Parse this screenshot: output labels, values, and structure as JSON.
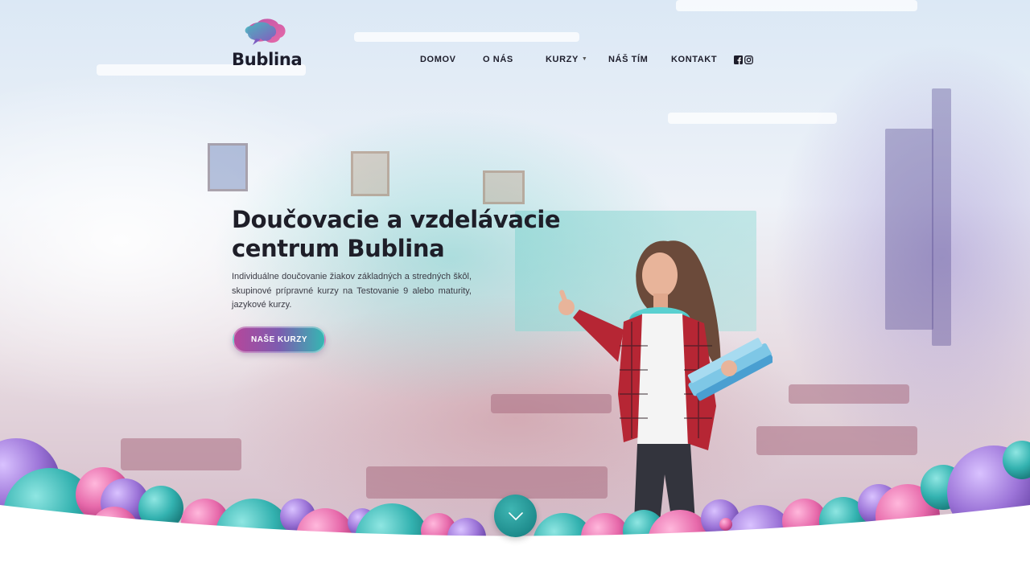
{
  "brand": {
    "name": "Bublina"
  },
  "nav": {
    "items": [
      {
        "label": "DOMOV"
      },
      {
        "label": "O NÁS"
      },
      {
        "label": "KURZY",
        "has_dropdown": true
      },
      {
        "label": "NÁŠ TÍM"
      },
      {
        "label": "KONTAKT"
      }
    ],
    "social": [
      "facebook-icon",
      "instagram-icon"
    ]
  },
  "hero": {
    "title_line1": "Doučovacie a vzdelávacie",
    "title_line2": "centrum Bublina",
    "description": "Individuálne doučovanie žiakov základných a stredných škôl, skupinové prípravné kurzy na Testovanie 9 alebo maturity, jazykové kurzy.",
    "cta_label": "NAŠE KURZY"
  },
  "colors": {
    "brand_pink": "#b5479b",
    "brand_purple": "#7c5cb0",
    "brand_teal": "#35b7b2",
    "text_dark": "#1e1e28"
  },
  "icons": {
    "scroll": "chevron-down-icon",
    "dropdown": "caret-down-icon"
  }
}
